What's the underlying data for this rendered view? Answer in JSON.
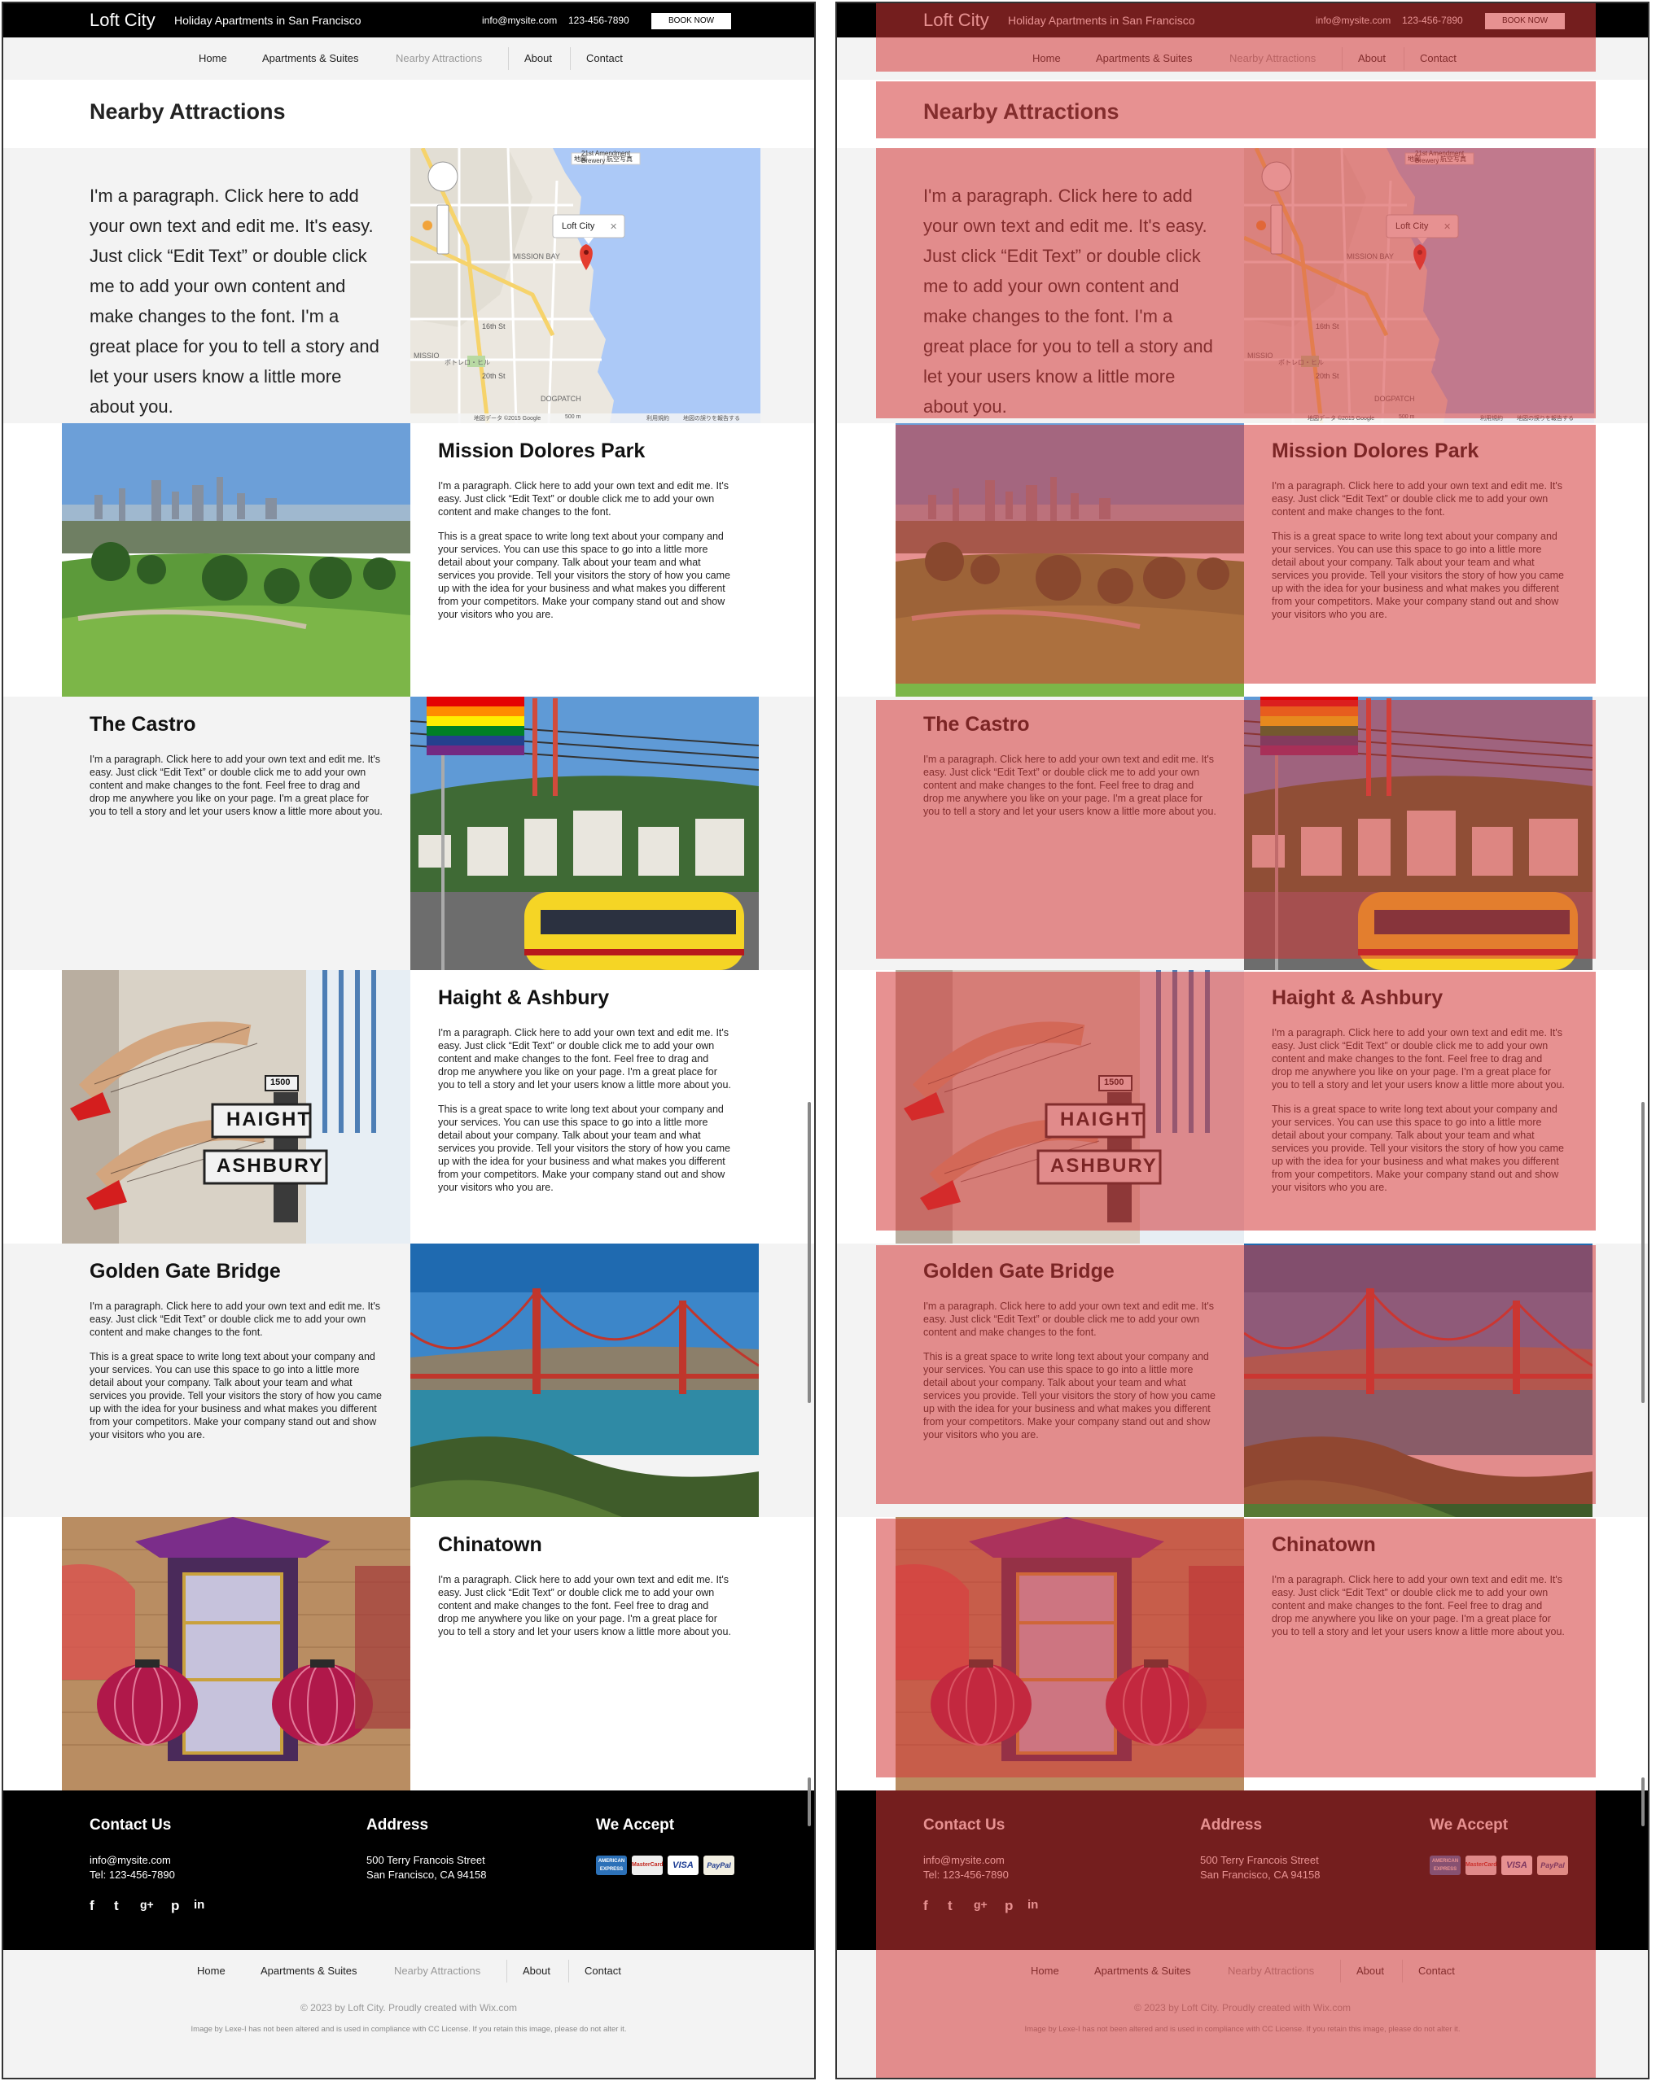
{
  "site": {
    "brand": "Loft City",
    "tagline": "Holiday Apartments in San Francisco",
    "email": "info@mysite.com",
    "phone": "123-456-7890",
    "book_label": "BOOK NOW"
  },
  "nav": {
    "items": [
      "Home",
      "Apartments & Suites",
      "Nearby Attractions",
      "About",
      "Contact"
    ],
    "active_index": 2
  },
  "page": {
    "title": "Nearby Attractions",
    "intro": "I'm a paragraph. Click here to add your own text and edit me. It's easy. Just click “Edit Text” or double click me to add your own content and make changes to the font. I'm a great place for you to tell a story and let your users know a little more about you."
  },
  "map": {
    "btn_map": "地図",
    "btn_satellite": "航空写真",
    "marker_label": "Loft City",
    "labels": {
      "brewery": "21st Amendment Brewery",
      "mission_bay": "MISSION BAY",
      "street_16": "16th St",
      "street_20": "20th St",
      "dogpatch": "DOGPATCH",
      "mission": "MISSIO",
      "potrero": "ポトレロ・ヒル",
      "scale": "500 m",
      "attribution": "地図データ ©2015 Google",
      "terms": "利用規約",
      "report": "地図の誤りを報告する"
    }
  },
  "attractions": [
    {
      "title": "Mission Dolores Park",
      "paragraphs": [
        "I'm a paragraph. Click here to add your own text and edit me. It's easy. Just click “Edit Text” or double click me to add your own content and make changes to the font.",
        "This is a great space to write long text about your company and your services. You can use this space to go into a little more detail about your company. Talk about your team and what services you provide. Tell your visitors the story of how you came up with the idea for your business and what makes you different from your competitors. Make your company stand out and show your visitors who you are."
      ]
    },
    {
      "title": "The Castro",
      "paragraphs": [
        "I'm a paragraph. Click here to add your own text and edit me. It's easy. Just click “Edit Text” or double click me to add your own content and make changes to the font. Feel free to drag and drop me anywhere you like on your page. I'm a great place for you to tell a story and let your users know a little more about you."
      ]
    },
    {
      "title": "Haight & Ashbury",
      "sign_top": "HAIGHT",
      "sign_bottom": "ASHBURY",
      "sign_small": "1500",
      "paragraphs": [
        "I'm a paragraph. Click here to add your own text and edit me. It's easy. Just click “Edit Text” or double click me to add your own content and make changes to the font. Feel free to drag and drop me anywhere you like on your page. I'm a great place for you to tell a story and let your users know a little more about you.",
        "This is a great space to write long text about your company and your services. You can use this space to go into a little more detail about your company. Talk about your team and what services you provide. Tell your visitors the story of how you came up with the idea for your business and what makes you different from your competitors. Make your company stand out and show your visitors who you are."
      ]
    },
    {
      "title": "Golden Gate Bridge",
      "paragraphs": [
        "I'm a paragraph. Click here to add your own text and edit me. It's easy. Just click “Edit Text” or double click me to add your own content and make changes to the font.",
        "This is a great space to write long text about your company and your services. You can use this space to go into a little more detail about your company. Talk about your team and what services you provide. Tell your visitors the story of how you came up with the idea for your business and what makes you different from your competitors. Make your company stand out and show your visitors who you are."
      ]
    },
    {
      "title": "Chinatown",
      "paragraphs": [
        "I'm a paragraph. Click here to add your own text and edit me. It's easy. Just click “Edit Text” or double click me to add your own content and make changes to the font. Feel free to drag and drop me anywhere you like on your page. I'm a great place for you to tell a story and let your users know a little more about you."
      ]
    }
  ],
  "footer": {
    "contact_title": "Contact Us",
    "contact_email": "info@mysite.com",
    "contact_tel": "Tel: 123-456-7890",
    "address_title": "Address",
    "address_line1": "500 Terry Francois Street",
    "address_line2": "San Francisco, CA  94158",
    "accept_title": "We Accept",
    "cards": [
      "AMERICAN EXPRESS",
      "MasterCard",
      "VISA",
      "PayPal"
    ],
    "social_icons": [
      "facebook-icon",
      "twitter-icon",
      "google-plus-icon",
      "pinterest-icon",
      "linkedin-icon"
    ],
    "copyright": "© 2023 by Loft City. Proudly created with Wix.com",
    "image_note": "Image by Lexe-I has not been altered and is used in compliance with CC License. If you retain this image, please do not alter it."
  },
  "colors": {
    "overlay": "#d43737",
    "topbar": "#000000",
    "nav_bg": "#f3f3f3",
    "nav_active": "#999999"
  }
}
